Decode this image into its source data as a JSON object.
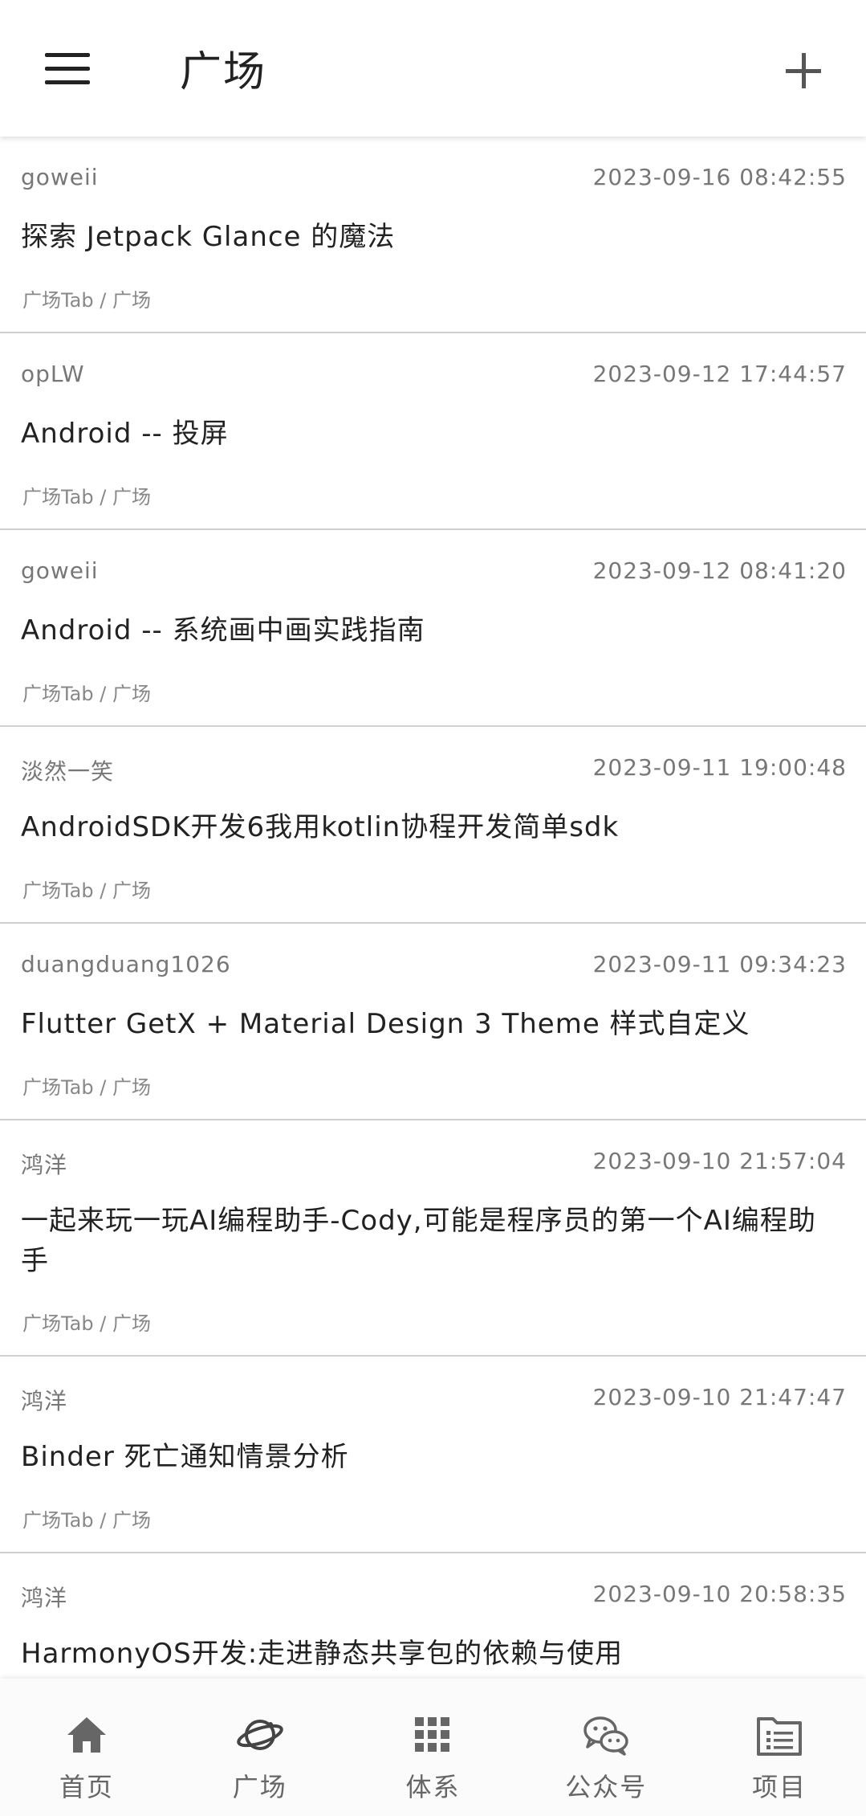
{
  "header": {
    "title": "广场"
  },
  "articles": [
    {
      "author": "goweii",
      "date": "2023-09-16 08:42:55",
      "title": "探索 Jetpack Glance 的魔法",
      "chapter": "广场Tab / 广场"
    },
    {
      "author": "opLW",
      "date": "2023-09-12 17:44:57",
      "title": "Android -- 投屏",
      "chapter": "广场Tab / 广场"
    },
    {
      "author": "goweii",
      "date": "2023-09-12 08:41:20",
      "title": "Android -- 系统画中画实践指南",
      "chapter": "广场Tab / 广场"
    },
    {
      "author": "淡然一笑",
      "date": "2023-09-11 19:00:48",
      "title": "AndroidSDK开发6我用kotlin协程开发简单sdk",
      "chapter": "广场Tab / 广场"
    },
    {
      "author": "duangduang1026",
      "date": "2023-09-11 09:34:23",
      "title": "Flutter GetX + Material Design 3 Theme 样式自定义",
      "chapter": "广场Tab / 广场"
    },
    {
      "author": "鸿洋",
      "date": "2023-09-10 21:57:04",
      "title": "一起来玩一玩AI编程助手-Cody,可能是程序员的第一个AI编程助手",
      "chapter": "广场Tab / 广场"
    },
    {
      "author": "鸿洋",
      "date": "2023-09-10 21:47:47",
      "title": "Binder 死亡通知情景分析",
      "chapter": "广场Tab / 广场"
    },
    {
      "author": "鸿洋",
      "date": "2023-09-10 20:58:35",
      "title": "HarmonyOS开发:走进静态共享包的依赖与使用",
      "chapter": ""
    }
  ],
  "bottom_nav": {
    "home": {
      "label": "首页",
      "icon": "home-icon"
    },
    "square": {
      "label": "广场",
      "icon": "planet-icon"
    },
    "system": {
      "label": "体系",
      "icon": "grid-icon"
    },
    "wechat": {
      "label": "公众号",
      "icon": "wechat-icon"
    },
    "project": {
      "label": "项目",
      "icon": "folder-list-icon"
    }
  },
  "colors": {
    "text_primary": "#222222",
    "text_secondary": "#777777",
    "divider": "#cfcfcf",
    "nav_icon": "#666666"
  }
}
